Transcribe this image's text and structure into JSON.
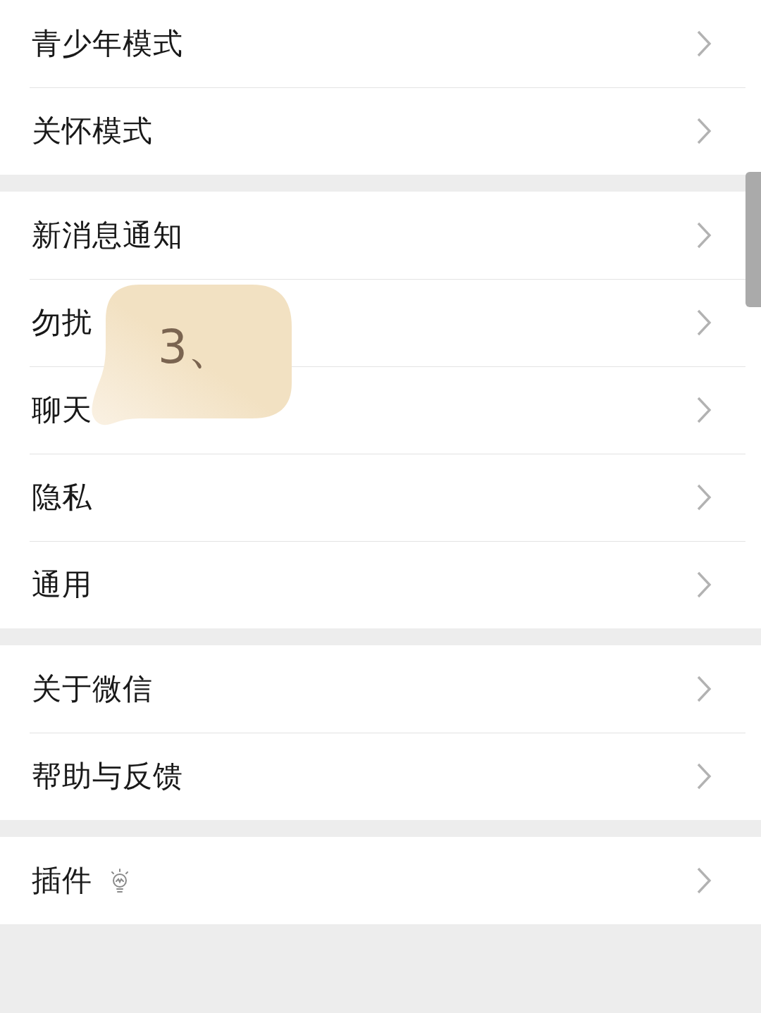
{
  "groups": [
    {
      "items": [
        {
          "label": "青少年模式",
          "kind": "plain"
        },
        {
          "label": "关怀模式",
          "kind": "plain"
        }
      ]
    },
    {
      "items": [
        {
          "label": "新消息通知",
          "kind": "plain"
        },
        {
          "label": "勿扰",
          "kind": "plain"
        },
        {
          "label": "聊天",
          "kind": "plain"
        },
        {
          "label": "隐私",
          "kind": "plain"
        },
        {
          "label": "通用",
          "kind": "plain"
        }
      ]
    },
    {
      "items": [
        {
          "label": "关于微信",
          "kind": "plain"
        },
        {
          "label": "帮助与反馈",
          "kind": "plain"
        }
      ]
    },
    {
      "items": [
        {
          "label": "插件",
          "kind": "with-icon"
        }
      ]
    }
  ],
  "annotation": {
    "text": "3、"
  }
}
